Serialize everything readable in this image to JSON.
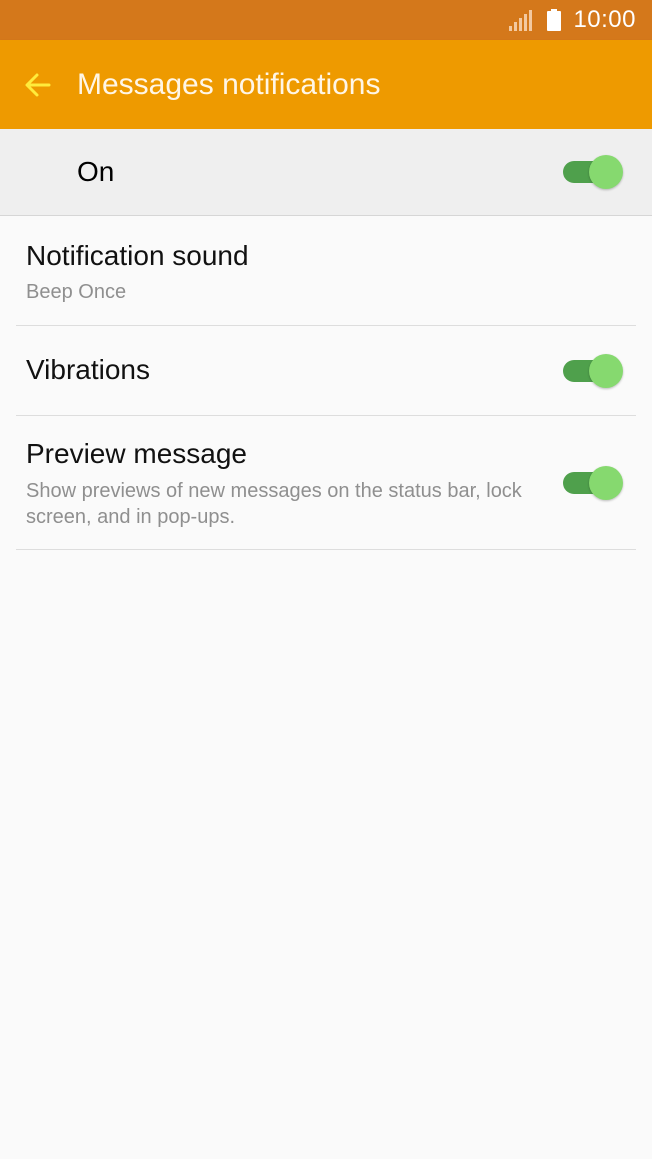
{
  "status_bar": {
    "time": "10:00",
    "signal_icon": "signal-bars-icon",
    "battery_icon": "battery-icon",
    "background_color": "#d4781b"
  },
  "app_bar": {
    "title": "Messages notifications",
    "back_icon": "back-arrow-icon",
    "background_color": "#ee9a00",
    "back_arrow_color": "#ffeb3b"
  },
  "master_switch": {
    "label": "On",
    "checked": true
  },
  "settings": {
    "notification_sound": {
      "title": "Notification sound",
      "value": "Beep Once"
    },
    "vibrations": {
      "title": "Vibrations",
      "checked": true
    },
    "preview_message": {
      "title": "Preview message",
      "description": "Show previews of new messages on the status bar, lock screen, and in pop-ups.",
      "checked": true
    }
  },
  "colors": {
    "toggle_track_on": "#4fa04c",
    "toggle_thumb_on": "#86d96f"
  }
}
